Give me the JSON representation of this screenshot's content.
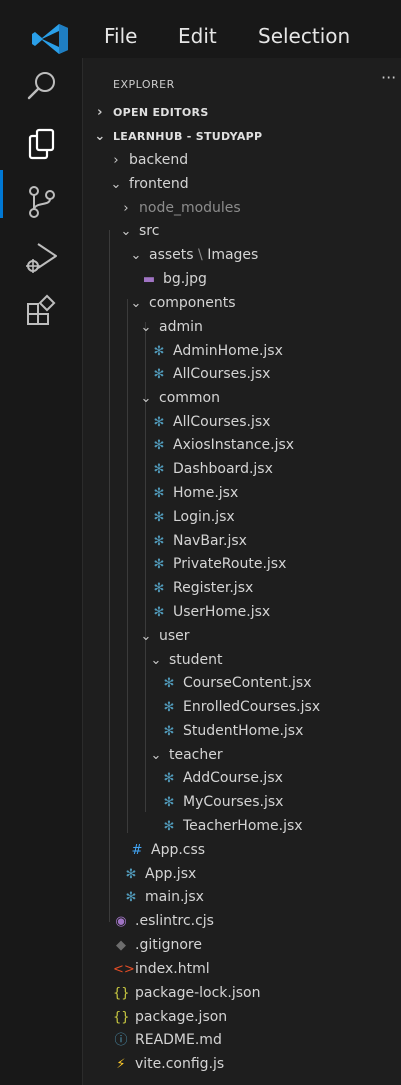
{
  "menu": {
    "file": "File",
    "edit": "Edit",
    "selection": "Selection"
  },
  "colors": {
    "accent": "#0078d4",
    "jsx_icon": "#519aba",
    "css_icon": "#42a5f5",
    "json_icon": "#cbcb41",
    "html_icon": "#e44d26",
    "eslint_icon": "#a074c4",
    "readme_icon": "#519aba",
    "vite_icon": "#ffcb2b",
    "image_icon": "#a074c4"
  },
  "explorer": {
    "title": "EXPLORER",
    "more": "···",
    "open_editors": "OPEN EDITORS",
    "project": "LEARNHUB - STUDYAPP",
    "tree": {
      "backend": "backend",
      "frontend": "frontend",
      "node_modules": "node_modules",
      "src": "src",
      "assets": "assets",
      "images": "Images",
      "bg": "bg.jpg",
      "components": "components",
      "admin": "admin",
      "admin_home": "AdminHome.jsx",
      "admin_allcourses": "AllCourses.jsx",
      "common": "common",
      "common_allcourses": "AllCourses.jsx",
      "axios": "AxiosInstance.jsx",
      "dashboard": "Dashboard.jsx",
      "home": "Home.jsx",
      "login": "Login.jsx",
      "navbar": "NavBar.jsx",
      "private_route": "PrivateRoute.jsx",
      "register": "Register.jsx",
      "user_home": "UserHome.jsx",
      "user": "user",
      "student": "student",
      "course_content": "CourseContent.jsx",
      "enrolled": "EnrolledCourses.jsx",
      "student_home": "StudentHome.jsx",
      "teacher": "teacher",
      "add_course": "AddCourse.jsx",
      "my_courses": "MyCourses.jsx",
      "teacher_home": "TeacherHome.jsx",
      "app_css": "App.css",
      "app_jsx": "App.jsx",
      "main_jsx": "main.jsx",
      "eslintrc": ".eslintrc.cjs",
      "gitignore": ".gitignore",
      "index_html": "index.html",
      "package_lock": "package-lock.json",
      "package_json": "package.json",
      "readme": "README.md",
      "vite_config": "vite.config.js"
    }
  }
}
